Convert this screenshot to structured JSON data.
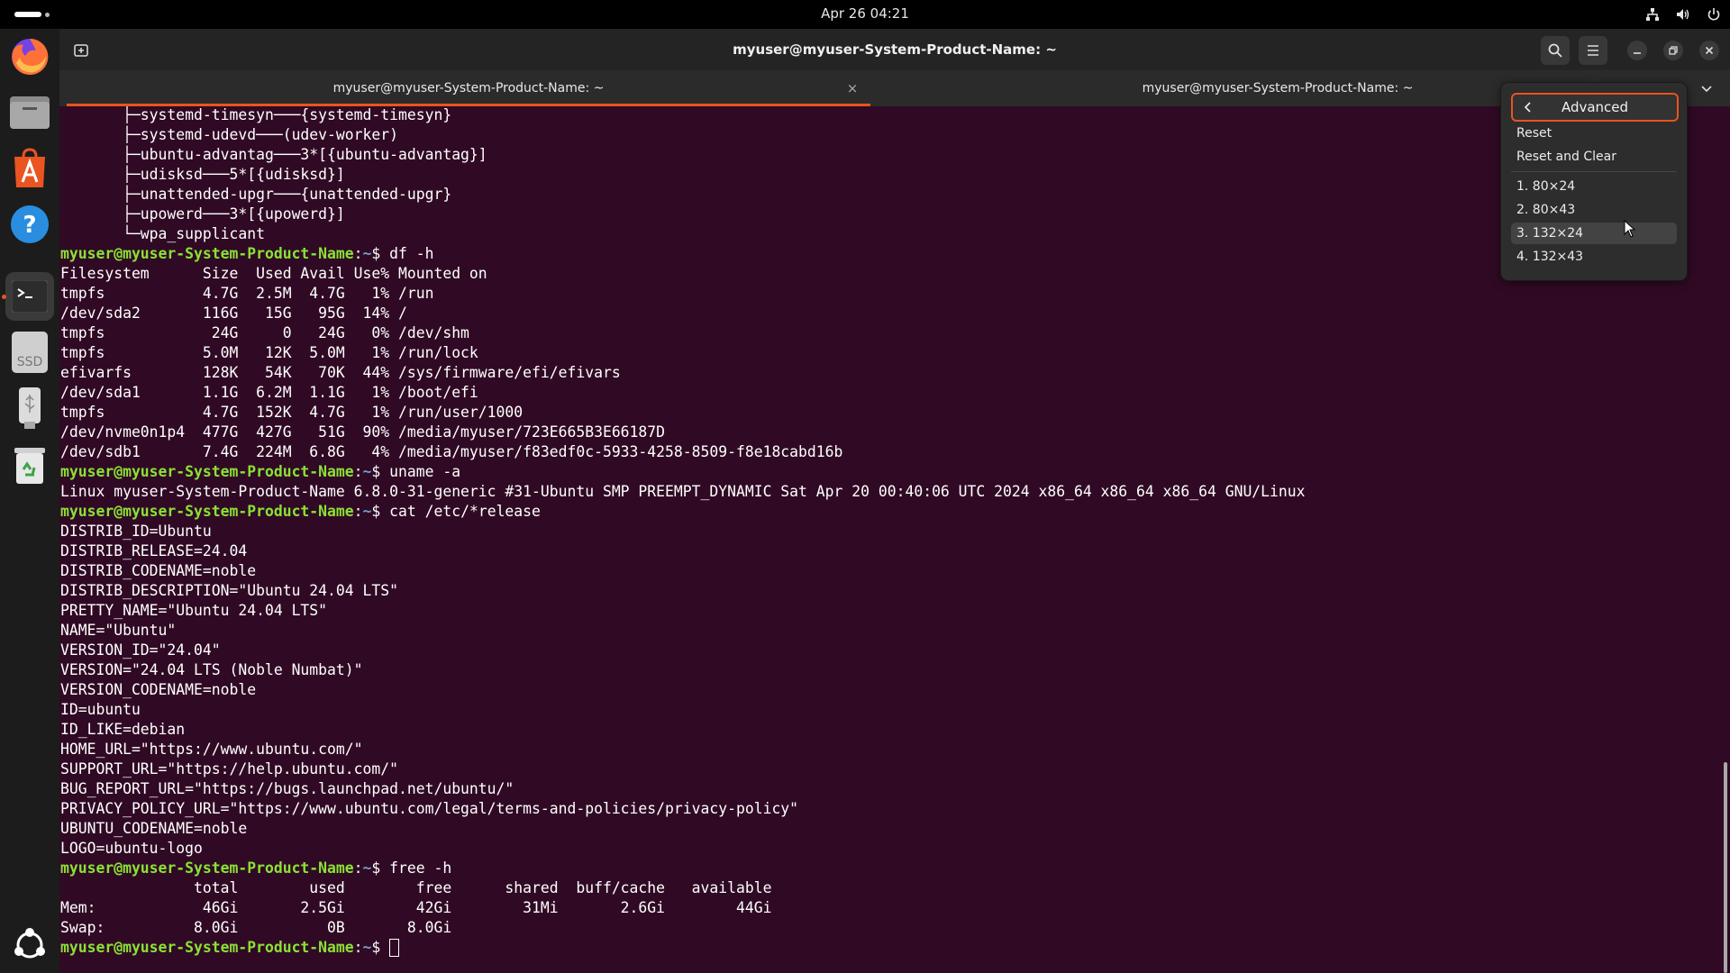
{
  "topbar": {
    "clock": "Apr 26  04:21",
    "icons": [
      "network-icon",
      "volume-icon",
      "power-icon"
    ]
  },
  "dock": {
    "items": [
      "firefox-icon",
      "files-icon",
      "app-center-icon",
      "help-icon",
      "terminal-icon",
      "ssd-drive-icon",
      "usb-drive-icon",
      "trash-icon",
      "show-apps-icon"
    ],
    "ssd_label": "SSD"
  },
  "window": {
    "title": "myuser@myuser-System-Product-Name: ~",
    "tabs": [
      {
        "label": "myuser@myuser-System-Product-Name: ~",
        "close": "×"
      },
      {
        "label": "myuser@myuser-System-Product-Name: ~"
      }
    ]
  },
  "colors": {
    "terminal_bg": "#300a24",
    "prompt_user": "#8ae234",
    "prompt_path": "#729fcf",
    "accent": "#e95420"
  },
  "terminal": {
    "prompt_user": "myuser@myuser-System-Product-Name",
    "prompt_sep": ":",
    "prompt_path": "~",
    "prompt_symbol": "$",
    "lines": [
      {
        "t": "out",
        "text": "       ├─systemd-timesyn───{systemd-timesyn}"
      },
      {
        "t": "out",
        "text": "       ├─systemd-udevd───(udev-worker)"
      },
      {
        "t": "out",
        "text": "       ├─ubuntu-advantag───3*[{ubuntu-advantag}]"
      },
      {
        "t": "out",
        "text": "       ├─udisksd───5*[{udisksd}]"
      },
      {
        "t": "out",
        "text": "       ├─unattended-upgr───{unattended-upgr}"
      },
      {
        "t": "out",
        "text": "       ├─upowerd───3*[{upowerd}]"
      },
      {
        "t": "out",
        "text": "       └─wpa_supplicant"
      },
      {
        "t": "cmd",
        "text": " df -h"
      },
      {
        "t": "out",
        "text": "Filesystem      Size  Used Avail Use% Mounted on"
      },
      {
        "t": "out",
        "text": "tmpfs           4.7G  2.5M  4.7G   1% /run"
      },
      {
        "t": "out",
        "text": "/dev/sda2       116G   15G   95G  14% /"
      },
      {
        "t": "out",
        "text": "tmpfs            24G     0   24G   0% /dev/shm"
      },
      {
        "t": "out",
        "text": "tmpfs           5.0M   12K  5.0M   1% /run/lock"
      },
      {
        "t": "out",
        "text": "efivarfs        128K   54K   70K  44% /sys/firmware/efi/efivars"
      },
      {
        "t": "out",
        "text": "/dev/sda1       1.1G  6.2M  1.1G   1% /boot/efi"
      },
      {
        "t": "out",
        "text": "tmpfs           4.7G  152K  4.7G   1% /run/user/1000"
      },
      {
        "t": "out",
        "text": "/dev/nvme0n1p4  477G  427G   51G  90% /media/myuser/723E665B3E66187D"
      },
      {
        "t": "out",
        "text": "/dev/sdb1       7.4G  224M  6.8G   4% /media/myuser/f83edf0c-5933-4258-8509-f8e18cabd16b"
      },
      {
        "t": "cmd",
        "text": " uname -a"
      },
      {
        "t": "out",
        "text": "Linux myuser-System-Product-Name 6.8.0-31-generic #31-Ubuntu SMP PREEMPT_DYNAMIC Sat Apr 20 00:40:06 UTC 2024 x86_64 x86_64 x86_64 GNU/Linux"
      },
      {
        "t": "cmd",
        "text": " cat /etc/*release"
      },
      {
        "t": "out",
        "text": "DISTRIB_ID=Ubuntu"
      },
      {
        "t": "out",
        "text": "DISTRIB_RELEASE=24.04"
      },
      {
        "t": "out",
        "text": "DISTRIB_CODENAME=noble"
      },
      {
        "t": "out",
        "text": "DISTRIB_DESCRIPTION=\"Ubuntu 24.04 LTS\""
      },
      {
        "t": "out",
        "text": "PRETTY_NAME=\"Ubuntu 24.04 LTS\""
      },
      {
        "t": "out",
        "text": "NAME=\"Ubuntu\""
      },
      {
        "t": "out",
        "text": "VERSION_ID=\"24.04\""
      },
      {
        "t": "out",
        "text": "VERSION=\"24.04 LTS (Noble Numbat)\""
      },
      {
        "t": "out",
        "text": "VERSION_CODENAME=noble"
      },
      {
        "t": "out",
        "text": "ID=ubuntu"
      },
      {
        "t": "out",
        "text": "ID_LIKE=debian"
      },
      {
        "t": "out",
        "text": "HOME_URL=\"https://www.ubuntu.com/\""
      },
      {
        "t": "out",
        "text": "SUPPORT_URL=\"https://help.ubuntu.com/\""
      },
      {
        "t": "out",
        "text": "BUG_REPORT_URL=\"https://bugs.launchpad.net/ubuntu/\""
      },
      {
        "t": "out",
        "text": "PRIVACY_POLICY_URL=\"https://www.ubuntu.com/legal/terms-and-policies/privacy-policy\""
      },
      {
        "t": "out",
        "text": "UBUNTU_CODENAME=noble"
      },
      {
        "t": "out",
        "text": "LOGO=ubuntu-logo"
      },
      {
        "t": "cmd",
        "text": " free -h"
      },
      {
        "t": "out",
        "text": "               total        used        free      shared  buff/cache   available"
      },
      {
        "t": "out",
        "text": "Mem:            46Gi       2.5Gi        42Gi        31Mi       2.6Gi        44Gi"
      },
      {
        "t": "out",
        "text": "Swap:          8.0Gi          0B       8.0Gi"
      },
      {
        "t": "cmd",
        "text": " ",
        "cursor": true
      }
    ]
  },
  "menu": {
    "title": "Advanced",
    "reset": "Reset",
    "reset_clear": "Reset and Clear",
    "sizes": [
      "1. 80×24",
      "2. 80×43",
      "3. 132×24",
      "4. 132×43"
    ],
    "highlighted": "3. 132×24"
  }
}
